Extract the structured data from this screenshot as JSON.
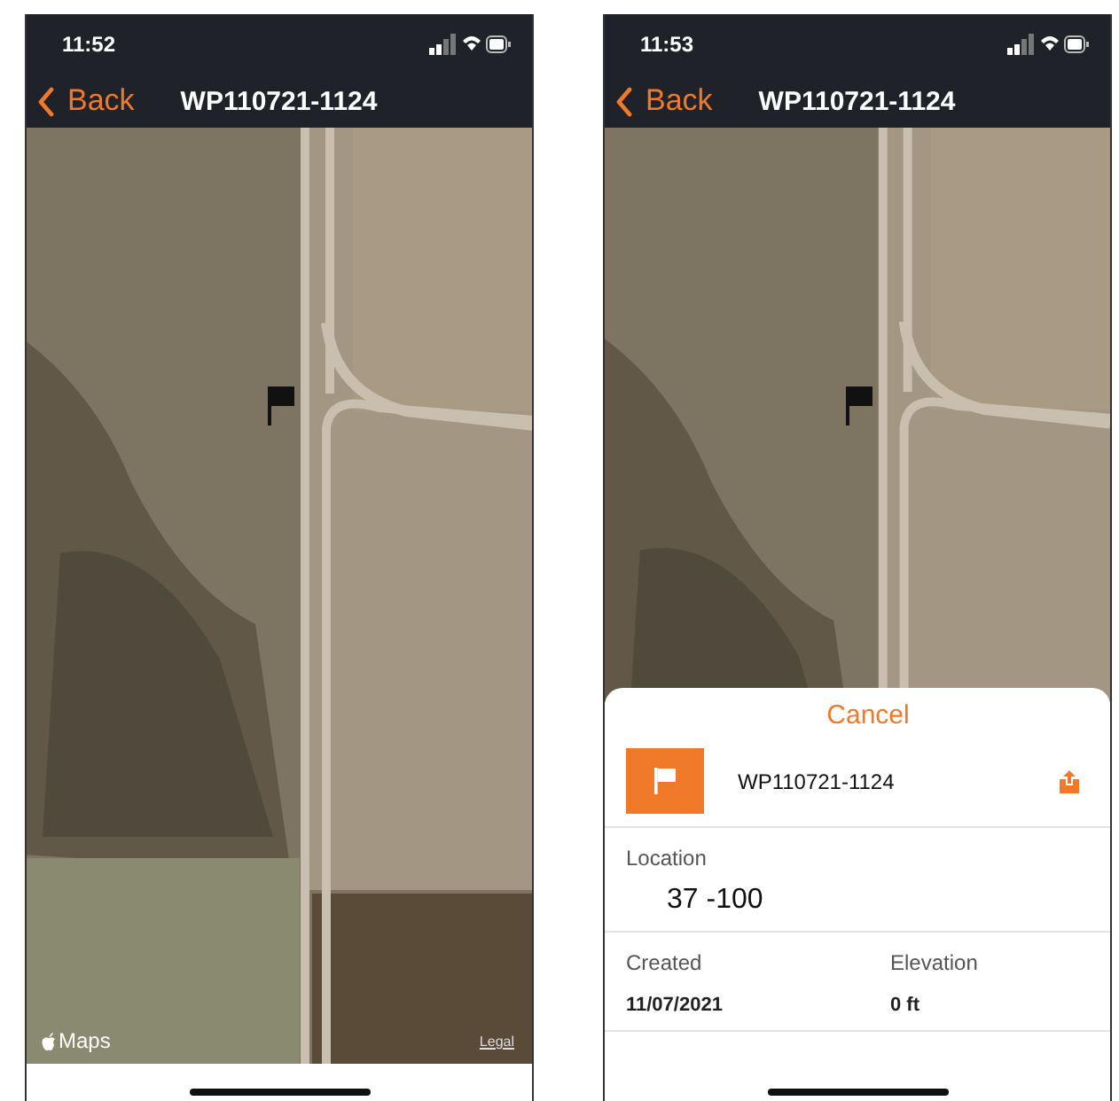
{
  "screens": [
    {
      "status_bar": {
        "time": "11:52"
      },
      "nav": {
        "back": "Back",
        "title": "WP110721-1124"
      },
      "map": {
        "attribution": "Maps",
        "legal": "Legal"
      }
    },
    {
      "status_bar": {
        "time": "11:53"
      },
      "nav": {
        "back": "Back",
        "title": "WP110721-1124"
      },
      "sheet": {
        "cancel": "Cancel",
        "waypoint_name": "WP110721-1124",
        "location_label": "Location",
        "location_value": "37 -100",
        "fields": [
          {
            "label": "Created",
            "value": "11/07/2021"
          },
          {
            "label": "Elevation",
            "value": "0 ft"
          }
        ]
      }
    }
  ]
}
